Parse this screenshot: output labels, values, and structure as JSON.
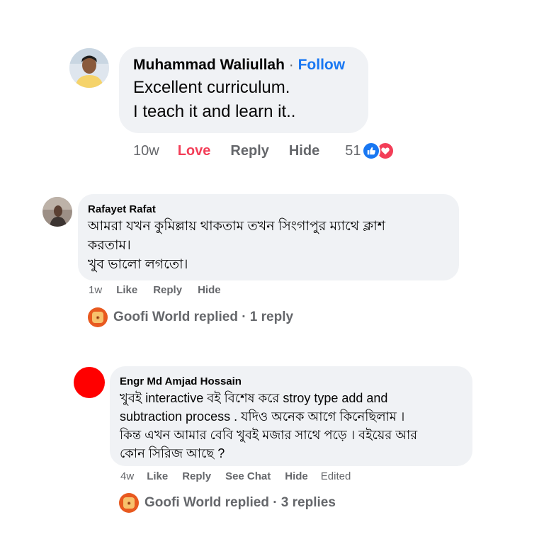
{
  "comments": [
    {
      "author": "Muhammad Waliullah",
      "separator": "·",
      "follow_label": "Follow",
      "lines": [
        "Excellent curriculum.",
        "I teach it and learn it.."
      ],
      "time": "10w",
      "like_label": "Love",
      "reply_label": "Reply",
      "hide_label": "Hide",
      "reaction_count": "51",
      "reaction_icons": [
        "thumbs-up-icon",
        "heart-icon"
      ]
    },
    {
      "author": "Rafayet Rafat",
      "lines": [
        "আমরা যখন কুমিল্লায় থাকতাম তখন সিংগাপুর ম্যাথে ক্লাশ",
        "করতাম।",
        "খুব ভালো লগতো।"
      ],
      "time": "1w",
      "like_label": "Like",
      "reply_label": "Reply",
      "hide_label": "Hide",
      "replied_text": "Goofi World replied · 1 reply"
    },
    {
      "author": "Engr Md Amjad Hossain",
      "lines": [
        "খুবই interactive বই বিশেষ করে stroy type add and",
        "subtraction process . যদিও অনেক আগে কিনেছিলাম ।",
        "কিন্ত এখন আমার বেবি খুবই মজার সাথে পড়ে । বইয়ের আর",
        "কোন সিরিজ আছে ?"
      ],
      "time": "4w",
      "like_label": "Like",
      "reply_label": "Reply",
      "chat_label": "See Chat",
      "hide_label": "Hide",
      "edited_label": "Edited",
      "replied_text": "Goofi World replied · 3 replies"
    }
  ],
  "colors": {
    "bubble": "#f0f2f5",
    "link_blue": "#1877f2",
    "love_red": "#f33e58",
    "muted": "#65676b",
    "avatar_red": "#ff0000",
    "page_logo": "#e8591f"
  }
}
